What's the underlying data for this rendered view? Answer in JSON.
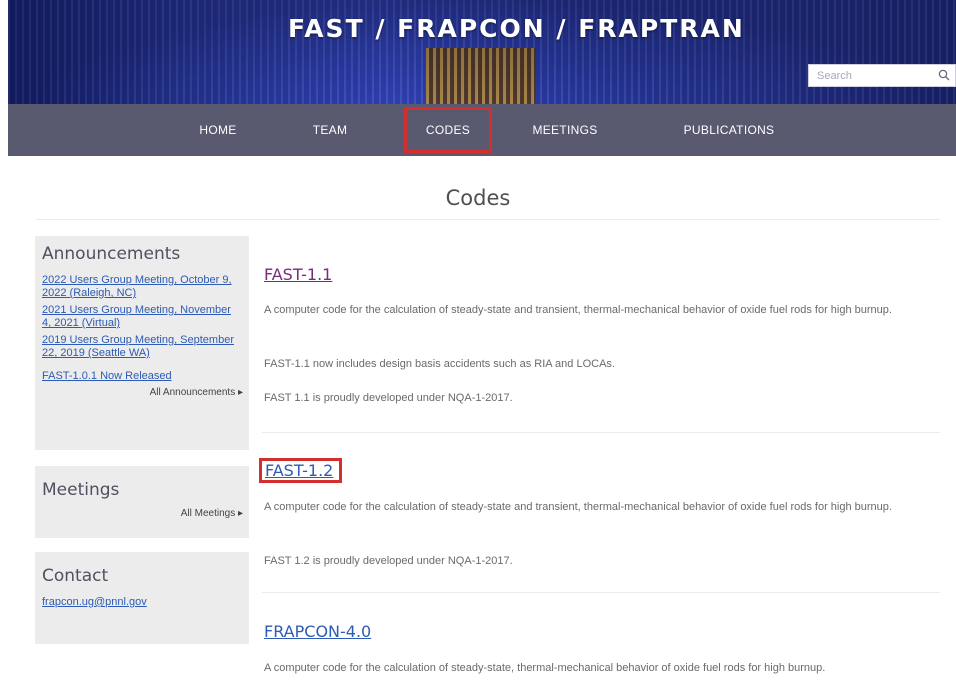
{
  "header": {
    "site_title": "FAST / FRAPCON / FRAPTRAN",
    "search_placeholder": "Search"
  },
  "nav": {
    "items": [
      {
        "label": "HOME"
      },
      {
        "label": "TEAM"
      },
      {
        "label": "CODES",
        "active": true
      },
      {
        "label": "MEETINGS"
      },
      {
        "label": "PUBLICATIONS"
      }
    ]
  },
  "page": {
    "title": "Codes"
  },
  "sidebar": {
    "announcements": {
      "heading": "Announcements",
      "links": [
        {
          "label": "2022 Users Group Meeting, October 9, 2022 (Raleigh, NC)"
        },
        {
          "label": "2021 Users Group Meeting, November 4, 2021 (Virtual)"
        },
        {
          "label": "2019 Users Group Meeting, September 22, 2019 (Seattle WA)"
        },
        {
          "label": "FAST-1.0.1 Now Released"
        }
      ],
      "more": "All Announcements ▸"
    },
    "meetings": {
      "heading": "Meetings",
      "more": "All Meetings ▸"
    },
    "contact": {
      "heading": "Contact",
      "email": "frapcon.ug@pnnl.gov"
    }
  },
  "codes": [
    {
      "title": "FAST-1.1",
      "paragraphs": [
        "A computer code for the calculation of steady-state and transient, thermal-mechanical behavior of oxide fuel rods for high burnup.",
        "FAST-1.1 now includes design basis accidents such as RIA and LOCAs.",
        "FAST 1.1 is proudly developed under NQA-1-2017."
      ]
    },
    {
      "title": "FAST-1.2",
      "paragraphs": [
        "A computer code for the calculation of steady-state and transient, thermal-mechanical behavior of oxide fuel rods for high burnup.",
        "FAST 1.2 is proudly developed under NQA-1-2017."
      ]
    },
    {
      "title": "FRAPCON-4.0",
      "paragraphs": [
        "A computer code for the calculation of steady-state, thermal-mechanical behavior of oxide fuel rods for high burnup."
      ]
    }
  ],
  "colors": {
    "nav_background": "#595970",
    "highlight_border": "#d32f2f",
    "link": "#2d5bb5",
    "visited_link": "#7a2a7a",
    "sidebar_background": "#ececec"
  },
  "icons": {
    "search": "search-icon"
  }
}
